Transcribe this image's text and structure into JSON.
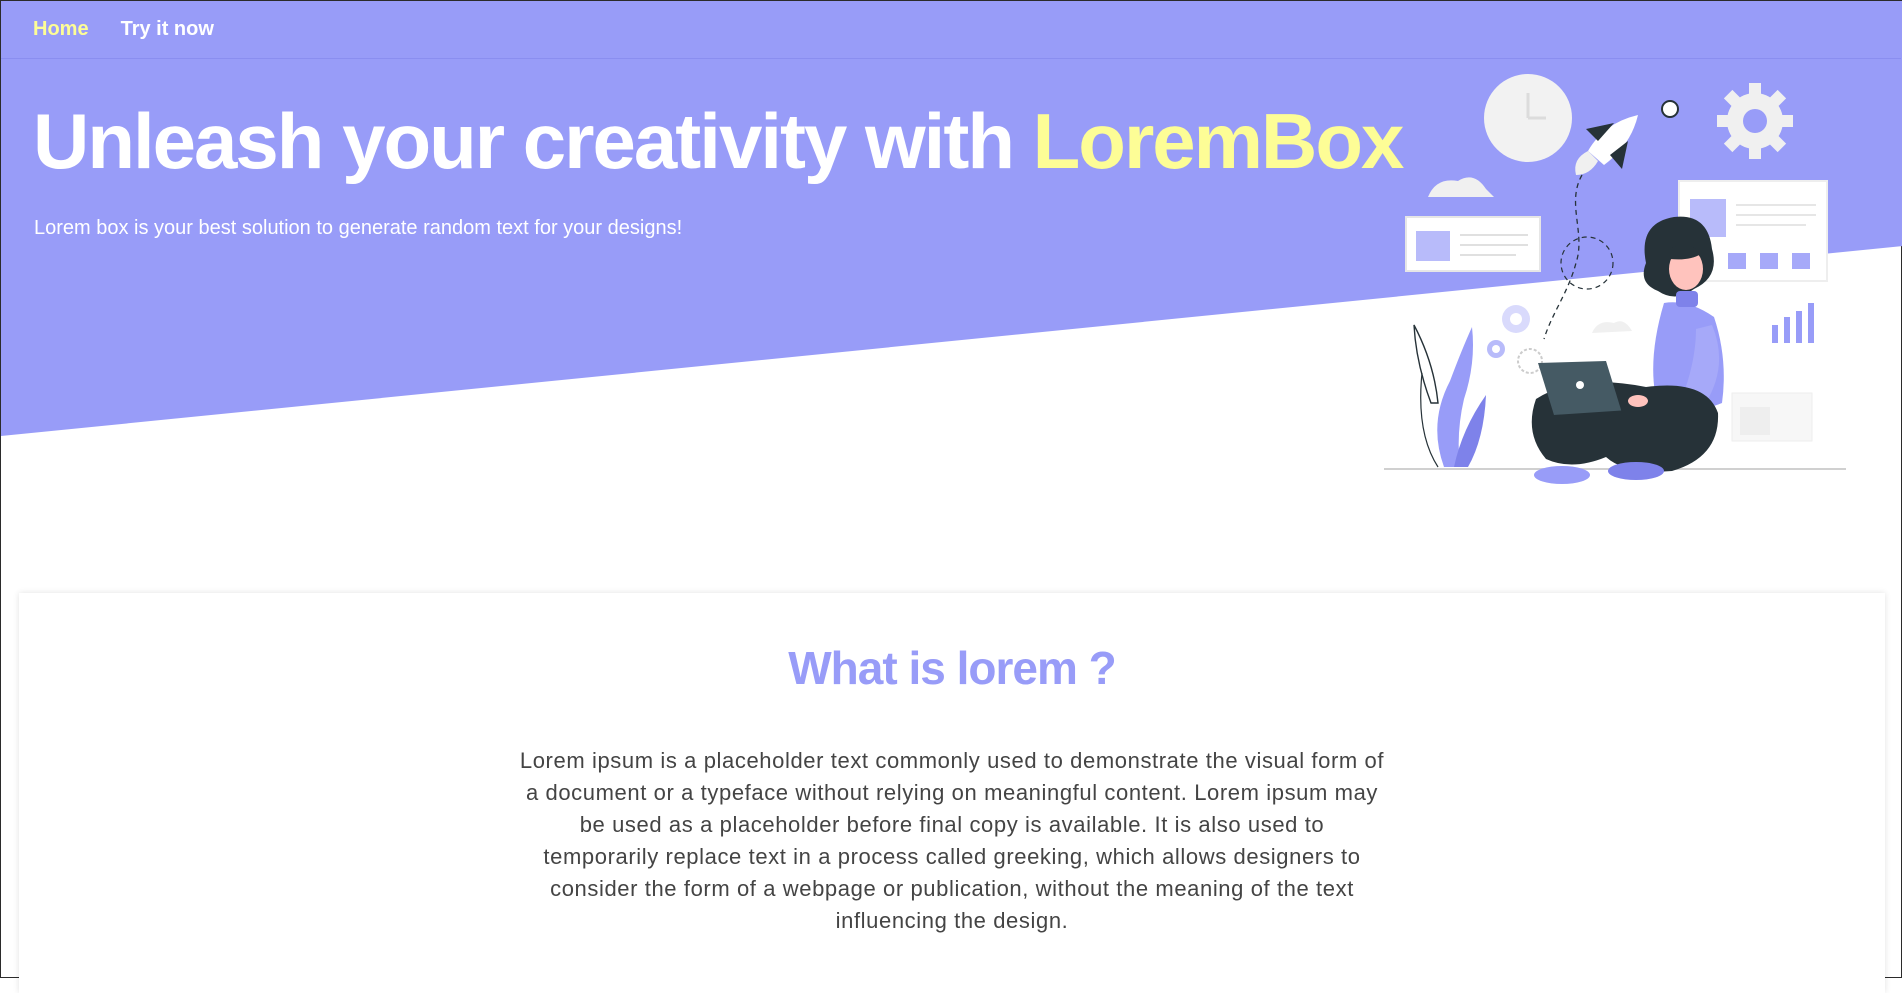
{
  "nav": {
    "home_label": "Home",
    "try_label": "Try it now"
  },
  "hero": {
    "title_main": "Unleash your creativity with ",
    "title_brand": "LoremBox",
    "subtitle": "Lorem box is your best solution to generate random text for your designs!"
  },
  "about": {
    "title": "What is lorem ?",
    "body": "Lorem ipsum is a placeholder text commonly used to demonstrate the visual form of a document or a typeface without relying on meaningful content. Lorem ipsum may be used as a placeholder before final copy is available. It is also used to temporarily replace text in a process called greeking, which allows designers to consider the form of a webpage or publication, without the meaning of the text influencing the design."
  },
  "colors": {
    "primary": "#989cf8",
    "accent": "#fdfd96",
    "text": "#444444",
    "dark": "#263238"
  },
  "illustration": {
    "icon": "woman-with-laptop-illustration"
  }
}
